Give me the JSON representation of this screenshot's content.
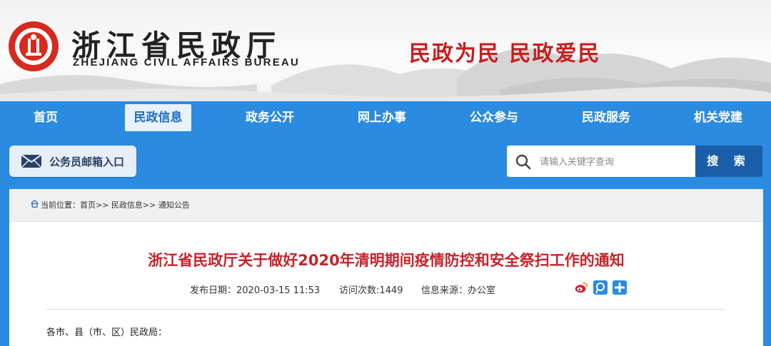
{
  "header": {
    "title_cn": "浙江省民政厅",
    "title_en": "ZHEJIANG CIVIL AFFAIRS BUREAU",
    "slogan": "民政为民  民政爱民",
    "brand_color": "#d62a20",
    "slogan_color": "#c61f1f"
  },
  "nav": {
    "items": [
      {
        "label": "首页",
        "active": false
      },
      {
        "label": "民政信息",
        "active": true
      },
      {
        "label": "政务公开",
        "active": false
      },
      {
        "label": "网上办事",
        "active": false
      },
      {
        "label": "公众参与",
        "active": false
      },
      {
        "label": "民政服务",
        "active": false
      },
      {
        "label": "机关党建",
        "active": false
      }
    ],
    "background_color": "#2a8be0"
  },
  "mailbox": {
    "label": "公务员邮箱入口",
    "icon": "envelope-icon"
  },
  "search": {
    "placeholder": "请输入关键字查询",
    "button_label": "搜 索",
    "icon": "search-icon"
  },
  "breadcrumb": {
    "icon": "home-icon",
    "text": "当前位置：首页>> 民政信息>> 通知公告"
  },
  "article": {
    "title": "浙江省民政厅关于做好2020年清明期间疫情防控和安全祭扫工作的通知",
    "publish_date": "发布日期：2020-03-15 11:53",
    "visits": "访问次数:1449",
    "source": "信息来源：办公室",
    "share_icons": [
      "weibo-icon",
      "tencent-weibo-icon",
      "share-plus-icon"
    ],
    "body_start": "各市、县（市、区）民政局："
  }
}
